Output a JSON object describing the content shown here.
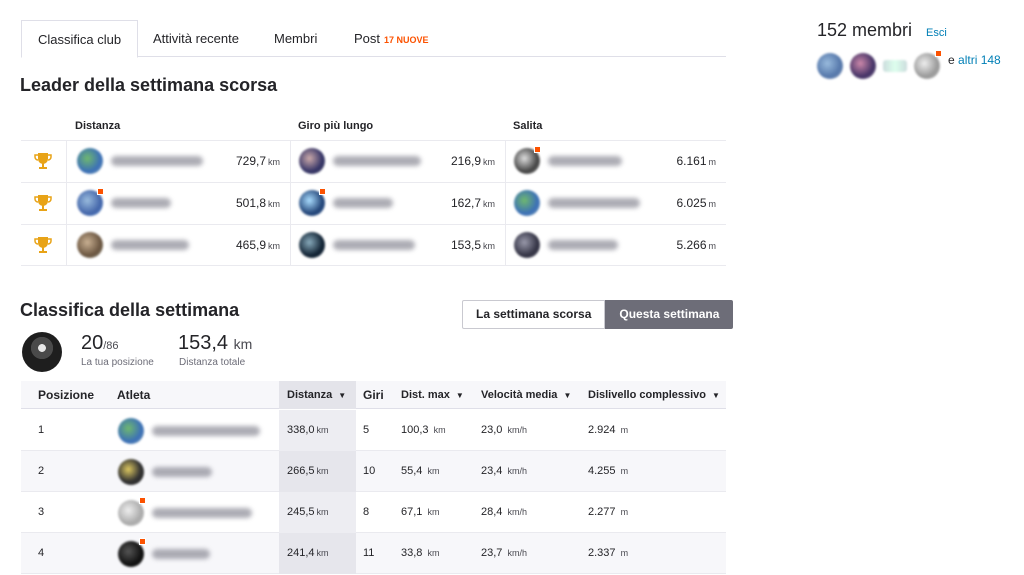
{
  "tabs": [
    {
      "label": "Classifica club",
      "active": true
    },
    {
      "label": "Attività recente",
      "active": false
    },
    {
      "label": "Membri",
      "active": false
    },
    {
      "label": "Post",
      "badge": "17 NUOVE",
      "active": false
    }
  ],
  "leaders": {
    "title": "Leader della settimana scorsa",
    "columns": [
      "Distanza",
      "Giro più lungo",
      "Salita"
    ],
    "rows": [
      {
        "distance": {
          "value": "729,7",
          "unit": "km"
        },
        "longest": {
          "value": "216,9",
          "unit": "km"
        },
        "climb": {
          "value": "6.161",
          "unit": "m"
        }
      },
      {
        "distance": {
          "value": "501,8",
          "unit": "km"
        },
        "longest": {
          "value": "162,7",
          "unit": "km"
        },
        "climb": {
          "value": "6.025",
          "unit": "m"
        }
      },
      {
        "distance": {
          "value": "465,9",
          "unit": "km"
        },
        "longest": {
          "value": "153,5",
          "unit": "km"
        },
        "climb": {
          "value": "5.266",
          "unit": "m"
        }
      }
    ],
    "trophy_color": "#e8a317"
  },
  "weekly": {
    "title": "Classifica della settimana",
    "toggle": {
      "last_week": "La settimana scorsa",
      "this_week": "Questa settimana"
    },
    "my_position": {
      "value": "20",
      "total": "/86",
      "label": "La tua posizione"
    },
    "my_distance": {
      "value": "153,4",
      "unit": "km",
      "label": "Distanza totale"
    },
    "headers": {
      "rank": "Posizione",
      "athlete": "Atleta",
      "distance": "Distanza",
      "rides": "Giri",
      "max": "Dist. max",
      "speed": "Velocità media",
      "elev": "Dislivello complessivo"
    },
    "rows": [
      {
        "rank": "1",
        "distance": "338,0",
        "rides": "5",
        "max": "100,3",
        "speed": "23,0",
        "elev": "2.924"
      },
      {
        "rank": "2",
        "distance": "266,5",
        "rides": "10",
        "max": "55,4",
        "speed": "23,4",
        "elev": "4.255"
      },
      {
        "rank": "3",
        "distance": "245,5",
        "rides": "8",
        "max": "67,1",
        "speed": "28,4",
        "elev": "2.277"
      },
      {
        "rank": "4",
        "distance": "241,4",
        "rides": "11",
        "max": "33,8",
        "speed": "23,7",
        "elev": "2.337"
      }
    ],
    "units": {
      "km": "km",
      "kmh": "km/h",
      "m": "m"
    }
  },
  "sidebar": {
    "members_title": "152 membri",
    "leave": "Esci",
    "and": "e",
    "more": "altri 148"
  },
  "colors": {
    "accent": "#fc5200",
    "link": "#007fb6"
  }
}
